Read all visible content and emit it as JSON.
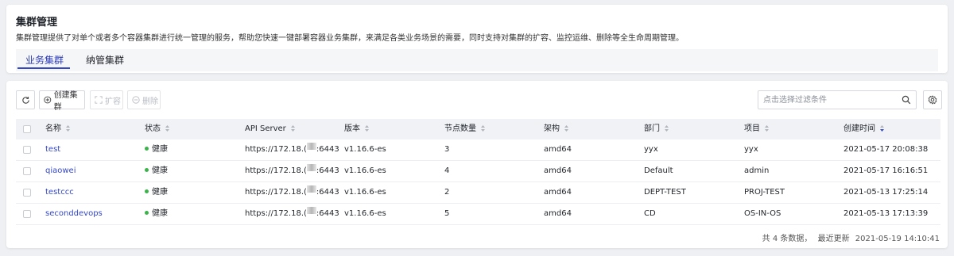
{
  "header": {
    "title": "集群管理",
    "description": "集群管理提供了对单个或者多个容器集群进行统一管理的服务，帮助您快速一键部署容器业务集群，来满足各类业务场景的需要，同时支持对集群的扩容、监控运维、删除等全生命周期管理。"
  },
  "tabs": [
    {
      "label": "业务集群",
      "active": true
    },
    {
      "label": "纳管集群",
      "active": false
    }
  ],
  "toolbar": {
    "refresh_icon": "refresh-icon",
    "create_label": "创建集群",
    "scale_label": "扩容",
    "delete_label": "删除",
    "filter_placeholder": "点击选择过滤条件"
  },
  "table": {
    "columns": [
      "名称",
      "状态",
      "API Server",
      "版本",
      "节点数量",
      "架构",
      "部门",
      "项目",
      "创建时间"
    ],
    "rows": [
      {
        "name": "test",
        "status": "健康",
        "api_prefix": "https://172.18.(",
        "api_suffix": ":6443",
        "version": "v1.16.6-es",
        "nodes": "3",
        "arch": "amd64",
        "dept": "yyx",
        "project": "yyx",
        "created": "2021-05-17 20:08:38"
      },
      {
        "name": "qiaowei",
        "status": "健康",
        "api_prefix": "https://172.18.(",
        "api_suffix": ":6443",
        "version": "v1.16.6-es",
        "nodes": "4",
        "arch": "amd64",
        "dept": "Default",
        "project": "admin",
        "created": "2021-05-17 16:16:51"
      },
      {
        "name": "testccc",
        "status": "健康",
        "api_prefix": "https://172.18.(",
        "api_suffix": ":6443",
        "version": "v1.16.6-es",
        "nodes": "2",
        "arch": "amd64",
        "dept": "DEPT-TEST",
        "project": "PROJ-TEST",
        "created": "2021-05-13 17:25:14"
      },
      {
        "name": "seconddevops",
        "status": "健康",
        "api_prefix": "https://172.18.(",
        "api_suffix": ":6443",
        "version": "v1.16.6-es",
        "nodes": "5",
        "arch": "amd64",
        "dept": "CD",
        "project": "OS-IN-OS",
        "created": "2021-05-13 17:13:39"
      }
    ]
  },
  "footer": {
    "count_text": "共 4 条数据，",
    "last_update_label": "最近更新",
    "last_update_time": "2021-05-19 14:10:41"
  },
  "colors": {
    "accent": "#3448c5",
    "healthy": "#3bb34a",
    "header_bg": "#f0f2f6"
  }
}
